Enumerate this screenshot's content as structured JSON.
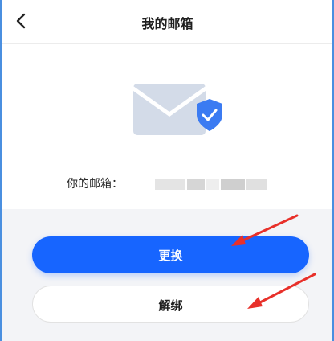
{
  "header": {
    "title": "我的邮箱",
    "back_icon": "chevron-left-icon"
  },
  "email": {
    "label": "你的邮箱："
  },
  "illustration": {
    "icon": "mail-shield-icon",
    "colors": {
      "envelope": "#c9d2e3",
      "shield": "#3b7bf2"
    }
  },
  "actions": {
    "change_label": "更换",
    "unbind_label": "解绑"
  },
  "colors": {
    "primary": "#1765ff",
    "annotation_arrow": "#e8302a"
  }
}
